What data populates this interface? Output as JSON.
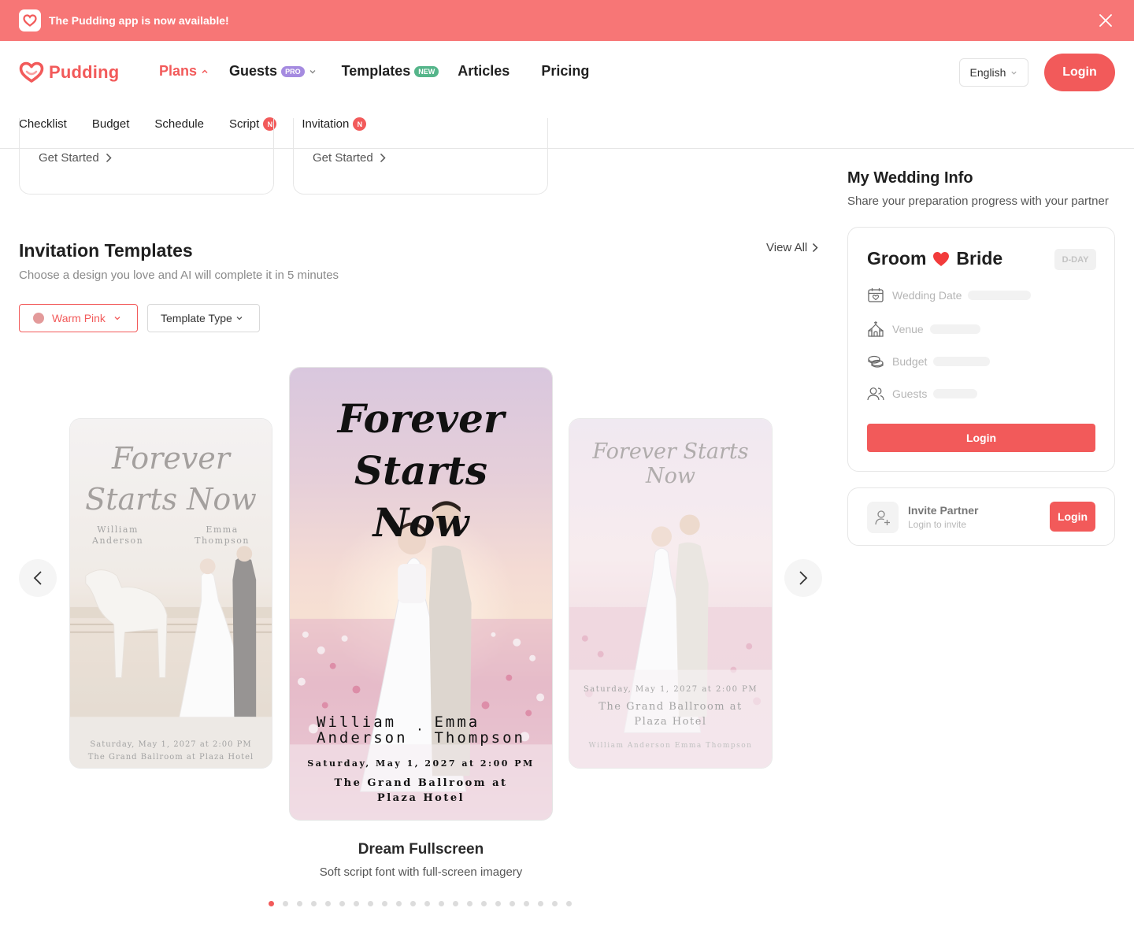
{
  "banner": {
    "text": "The Pudding app is now available!",
    "icon": "app-heart-icon",
    "close_icon": "close-icon"
  },
  "brand": {
    "name": "Pudding",
    "color": "#f25a5a"
  },
  "nav": {
    "plans": "Plans",
    "guests": "Guests",
    "guests_badge": "PRO",
    "templates": "Templates",
    "templates_badge": "NEW",
    "articles": "Articles",
    "pricing": "Pricing",
    "language": "English",
    "login": "Login"
  },
  "subnav": {
    "checklist": "Checklist",
    "budget": "Budget",
    "schedule": "Schedule",
    "script": "Script",
    "script_badge": "N",
    "invitation": "Invitation",
    "invitation_badge": "N"
  },
  "tool_cards": [
    {
      "cta": "Get Started"
    },
    {
      "cta": "Get Started"
    }
  ],
  "invitation_templates": {
    "title": "Invitation Templates",
    "subtitle": "Choose a design you love and AI will complete it in 5 minutes",
    "view_all": "View All",
    "filter_color": "Warm Pink",
    "filter_type": "Template Type",
    "cards": [
      {
        "script": "Forever Starts Now",
        "groom_first": "William",
        "groom_last": "Anderson",
        "bride_first": "Emma",
        "bride_last": "Thompson",
        "date": "Saturday, May 1, 2027 at 2:00 PM",
        "venue": "The Grand Ballroom at Plaza Hotel"
      },
      {
        "script_line1": "Forever",
        "script_line2": "Starts Now",
        "groom_first": "William",
        "groom_last": "Anderson",
        "bride_first": "Emma",
        "bride_last": "Thompson",
        "separator": "·",
        "date": "Saturday, May 1, 2027 at 2:00 PM",
        "venue": "The Grand Ballroom at Plaza Hotel"
      },
      {
        "script": "Forever Starts Now",
        "date": "Saturday, May 1, 2027 at 2:00 PM",
        "venue": "The Grand Ballroom at Plaza Hotel",
        "names_line": "William Anderson   Emma Thompson"
      }
    ],
    "active_name": "Dream Fullscreen",
    "active_desc": "Soft script font with full-screen imagery",
    "page_count": 22,
    "active_page": 1
  },
  "wedding_info": {
    "title": "My Wedding Info",
    "subtitle": "Share your preparation progress with your partner",
    "groom": "Groom",
    "bride": "Bride",
    "dday": "D-DAY",
    "rows": [
      "Wedding Date",
      "Venue",
      "Budget",
      "Guests"
    ],
    "login": "Login"
  },
  "invite_partner": {
    "title": "Invite Partner",
    "subtitle": "Login to invite",
    "login": "Login"
  }
}
